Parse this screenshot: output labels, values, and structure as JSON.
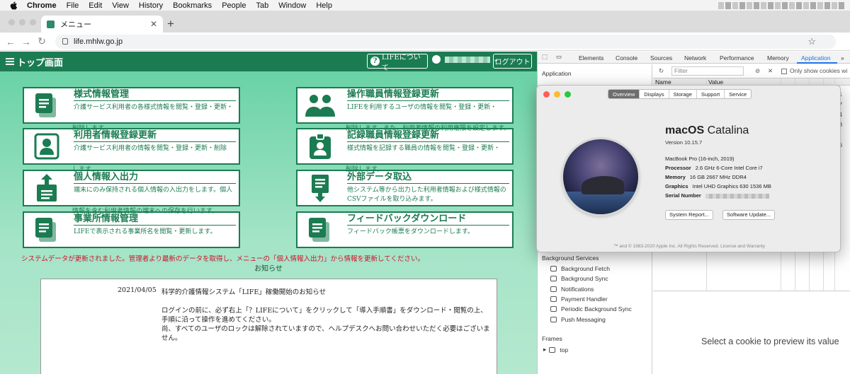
{
  "menubar": {
    "app": "Chrome",
    "items": [
      "File",
      "Edit",
      "View",
      "History",
      "Bookmarks",
      "People",
      "Tab",
      "Window",
      "Help"
    ]
  },
  "browser": {
    "tab_title": "メニュー",
    "url": "life.mhlw.go.jp"
  },
  "page": {
    "header": {
      "title": "トップ画面",
      "about_button": "LIFEについて",
      "logout_button": "ログアウト"
    },
    "cards": [
      {
        "title": "様式情報管理",
        "desc": "介護サービス利用者の各様式情報を閲覧・登録・更新・",
        "overflow": "削除します。",
        "icon": "document-icon"
      },
      {
        "title": "操作職員情報登録更新",
        "desc": "LIFEを利用するユーザの情報を閲覧・登録・更新・",
        "overflow": "削除します。また、利用者情報の利用権限を設定します。",
        "icon": "users-icon"
      },
      {
        "title": "利用者情報登録更新",
        "desc": "介護サービス利用者の情報を閲覧・登録・更新・削除",
        "overflow": "します。",
        "icon": "user-card-icon"
      },
      {
        "title": "記録職員情報登録更新",
        "desc": "様式情報を記録する職員の情報を閲覧・登録・更新・",
        "overflow": "削除します。",
        "icon": "badge-icon"
      },
      {
        "title": "個人情報入出力",
        "desc": "端末にのみ保持される個人情報の入出力をします。個人",
        "overflow": "情報を含む利用者情報の端末への保存を行います。",
        "icon": "upload-icon"
      },
      {
        "title": "外部データ取込",
        "desc": "他システム等から出力した利用者情報および様式情報のCSVファイルを取り込みます。",
        "overflow": "",
        "icon": "import-icon"
      },
      {
        "title": "事業所情報管理",
        "desc": "LIFEで表示される事業所名を閲覧・更新します。",
        "overflow": "",
        "icon": "office-doc-icon"
      },
      {
        "title": "フィードバックダウンロード",
        "desc": "フィードバック帳票をダウンロードします。",
        "overflow": "",
        "icon": "feedback-doc-icon"
      }
    ],
    "system_message": "システムデータが更新されました。管理者より最新のデータを取得し、メニューの「個人情報入出力」から情報を更新してください。",
    "news_heading": "お知らせ",
    "news": {
      "date": "2021/04/05",
      "title": "科学的介護情報システム「LIFE」稼働開始のお知らせ",
      "body": "ログインの前に、必ず右上「？LIFEについて」をクリックして「導入手順書」をダウンロード・閲覧の上、手順に沿って操作を進めてください。\n尚、すべてのユーザのロックは解除されていますので、ヘルプデスクへお問い合わせいただく必要はございません。"
    }
  },
  "devtools": {
    "tabs": [
      "Elements",
      "Console",
      "Sources",
      "Network",
      "Performance",
      "Memory",
      "Application"
    ],
    "active_tab": "Application",
    "more": "»",
    "sidebar_header": "Application",
    "filter_placeholder": "Filter",
    "only_show_cookies": "Only show cookies wi",
    "col_name": "Name",
    "col_value": "Value",
    "partial_numbers": [
      "71",
      "77",
      "94",
      "08",
      "7",
      "86"
    ],
    "bg_services_header": "Background Services",
    "bg_services": [
      "Background Fetch",
      "Background Sync",
      "Notifications",
      "Payment Handler",
      "Periodic Background Sync",
      "Push Messaging"
    ],
    "frames_header": "Frames",
    "frames_item": "top",
    "preview_message": "Select a cookie to preview its value"
  },
  "about": {
    "tabs": [
      "Overview",
      "Displays",
      "Storage",
      "Support",
      "Service"
    ],
    "active_tab": "Overview",
    "os_name_bold": "macOS",
    "os_name": "Catalina",
    "version": "Version 10.15.7",
    "model": "MacBook Pro (16-inch, 2019)",
    "processor_label": "Processor",
    "processor": "2.6 GHz 6-Core Intel Core i7",
    "memory_label": "Memory",
    "memory": "16 GB 2667 MHz DDR4",
    "graphics_label": "Graphics",
    "graphics": "Intel UHD Graphics 630 1536 MB",
    "serial_label": "Serial Number",
    "system_report_button": "System Report...",
    "software_update_button": "Software Update...",
    "footer": "™ and © 1983-2020 Apple Inc. All Rights Reserved. License and Warranty"
  }
}
